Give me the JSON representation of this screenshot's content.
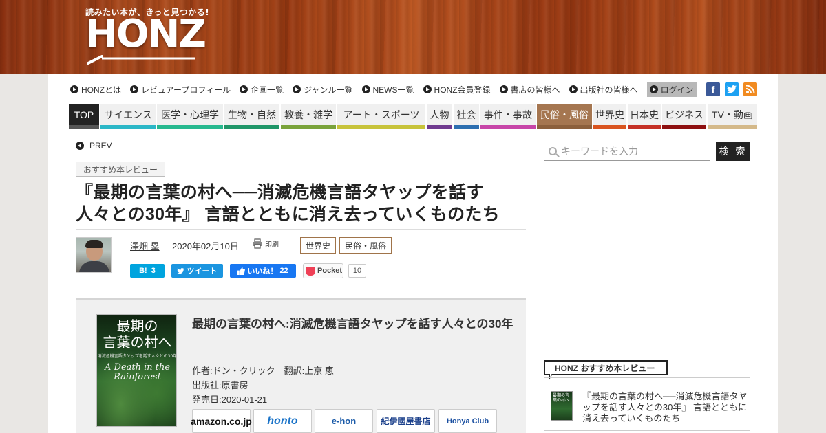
{
  "header": {
    "tagline": "読みたい本が、きっと見つかる!",
    "logo": "HONZ"
  },
  "topnav": [
    {
      "label": "HONZとは"
    },
    {
      "label": "レビュアープロフィール"
    },
    {
      "label": "企画一覧"
    },
    {
      "label": "ジャンル一覧"
    },
    {
      "label": "NEWS一覧"
    },
    {
      "label": "HONZ会員登録"
    },
    {
      "label": "書店の皆様へ"
    },
    {
      "label": "出版社の皆様へ"
    },
    {
      "label": "ログイン"
    }
  ],
  "social": {
    "facebook": "f",
    "twitter": "t",
    "rss": "rss"
  },
  "genres": [
    {
      "label": "TOP",
      "color": "#222222"
    },
    {
      "label": "サイエンス",
      "color": "#2bb7c7"
    },
    {
      "label": "医学・心理学",
      "color": "#27b98f"
    },
    {
      "label": "生物・自然",
      "color": "#1f9668"
    },
    {
      "label": "教養・雑学",
      "color": "#7aa33a"
    },
    {
      "label": "アート・スポーツ",
      "color": "#c7c33a"
    },
    {
      "label": "人物",
      "color": "#6f3a8f"
    },
    {
      "label": "社会",
      "color": "#2d6fb0"
    },
    {
      "label": "事件・事故",
      "color": "#c745a8"
    },
    {
      "label": "民俗・風俗",
      "color": "#a57650"
    },
    {
      "label": "世界史",
      "color": "#d9541f"
    },
    {
      "label": "日本史",
      "color": "#c43025"
    },
    {
      "label": "ビジネス",
      "color": "#8e0f10"
    },
    {
      "label": "TV・動画",
      "color": "#d4b98a"
    }
  ],
  "article": {
    "prev": "PREV",
    "category": "おすすめ本レビュー",
    "title_line1": "『最期の言葉の村へ──消滅危機言語タヤップを話す",
    "title_line2": "人々との30年』 言語とともに消え去っていくものたち",
    "author": "澤畑 塁",
    "date": "2020年02月10日",
    "print": "印刷",
    "tags": [
      "世界史",
      "民俗・風俗"
    ],
    "share": {
      "hatena_label": "B!",
      "hatena_count": "3",
      "tweet": "ツイート",
      "like": "いいね！",
      "like_count": "22",
      "pocket": "Pocket",
      "pocket_count": "10"
    }
  },
  "book": {
    "cover_title": "最期の\n言葉の村へ",
    "cover_sub": "消滅危機言語タヤップを話す人々との30年",
    "cover_en": "A Death in the Rainforest",
    "title": "最期の言葉の村へ:消滅危機言語タヤップを話す人々との30年",
    "author": "作者:ドン・クリック　翻訳:上京 恵",
    "publisher": "出版社:原書房",
    "release": "発売日:2020-01-21",
    "stores": [
      "amazon.co.jp",
      "honto",
      "e-hon",
      "紀伊國屋書店",
      "Honya Club"
    ]
  },
  "sidebar": {
    "search_placeholder": "キーワードを入力",
    "search_button": "検 索",
    "rec_heading": "HONZ おすすめ本レビュー",
    "rec_item": "『最期の言葉の村へ──消滅危機言語タヤップを話す人々との30年』 言語とともに消え去っていくものたち",
    "rec_thumb_text": "最期の言葉の村へ"
  }
}
